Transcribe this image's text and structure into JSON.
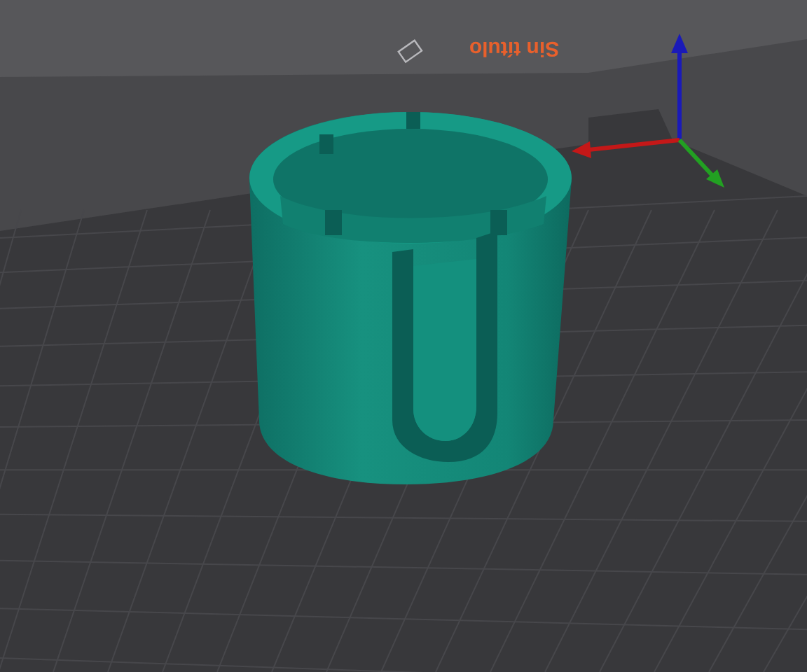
{
  "viewport": {
    "plate_name": "Sin título"
  }
}
